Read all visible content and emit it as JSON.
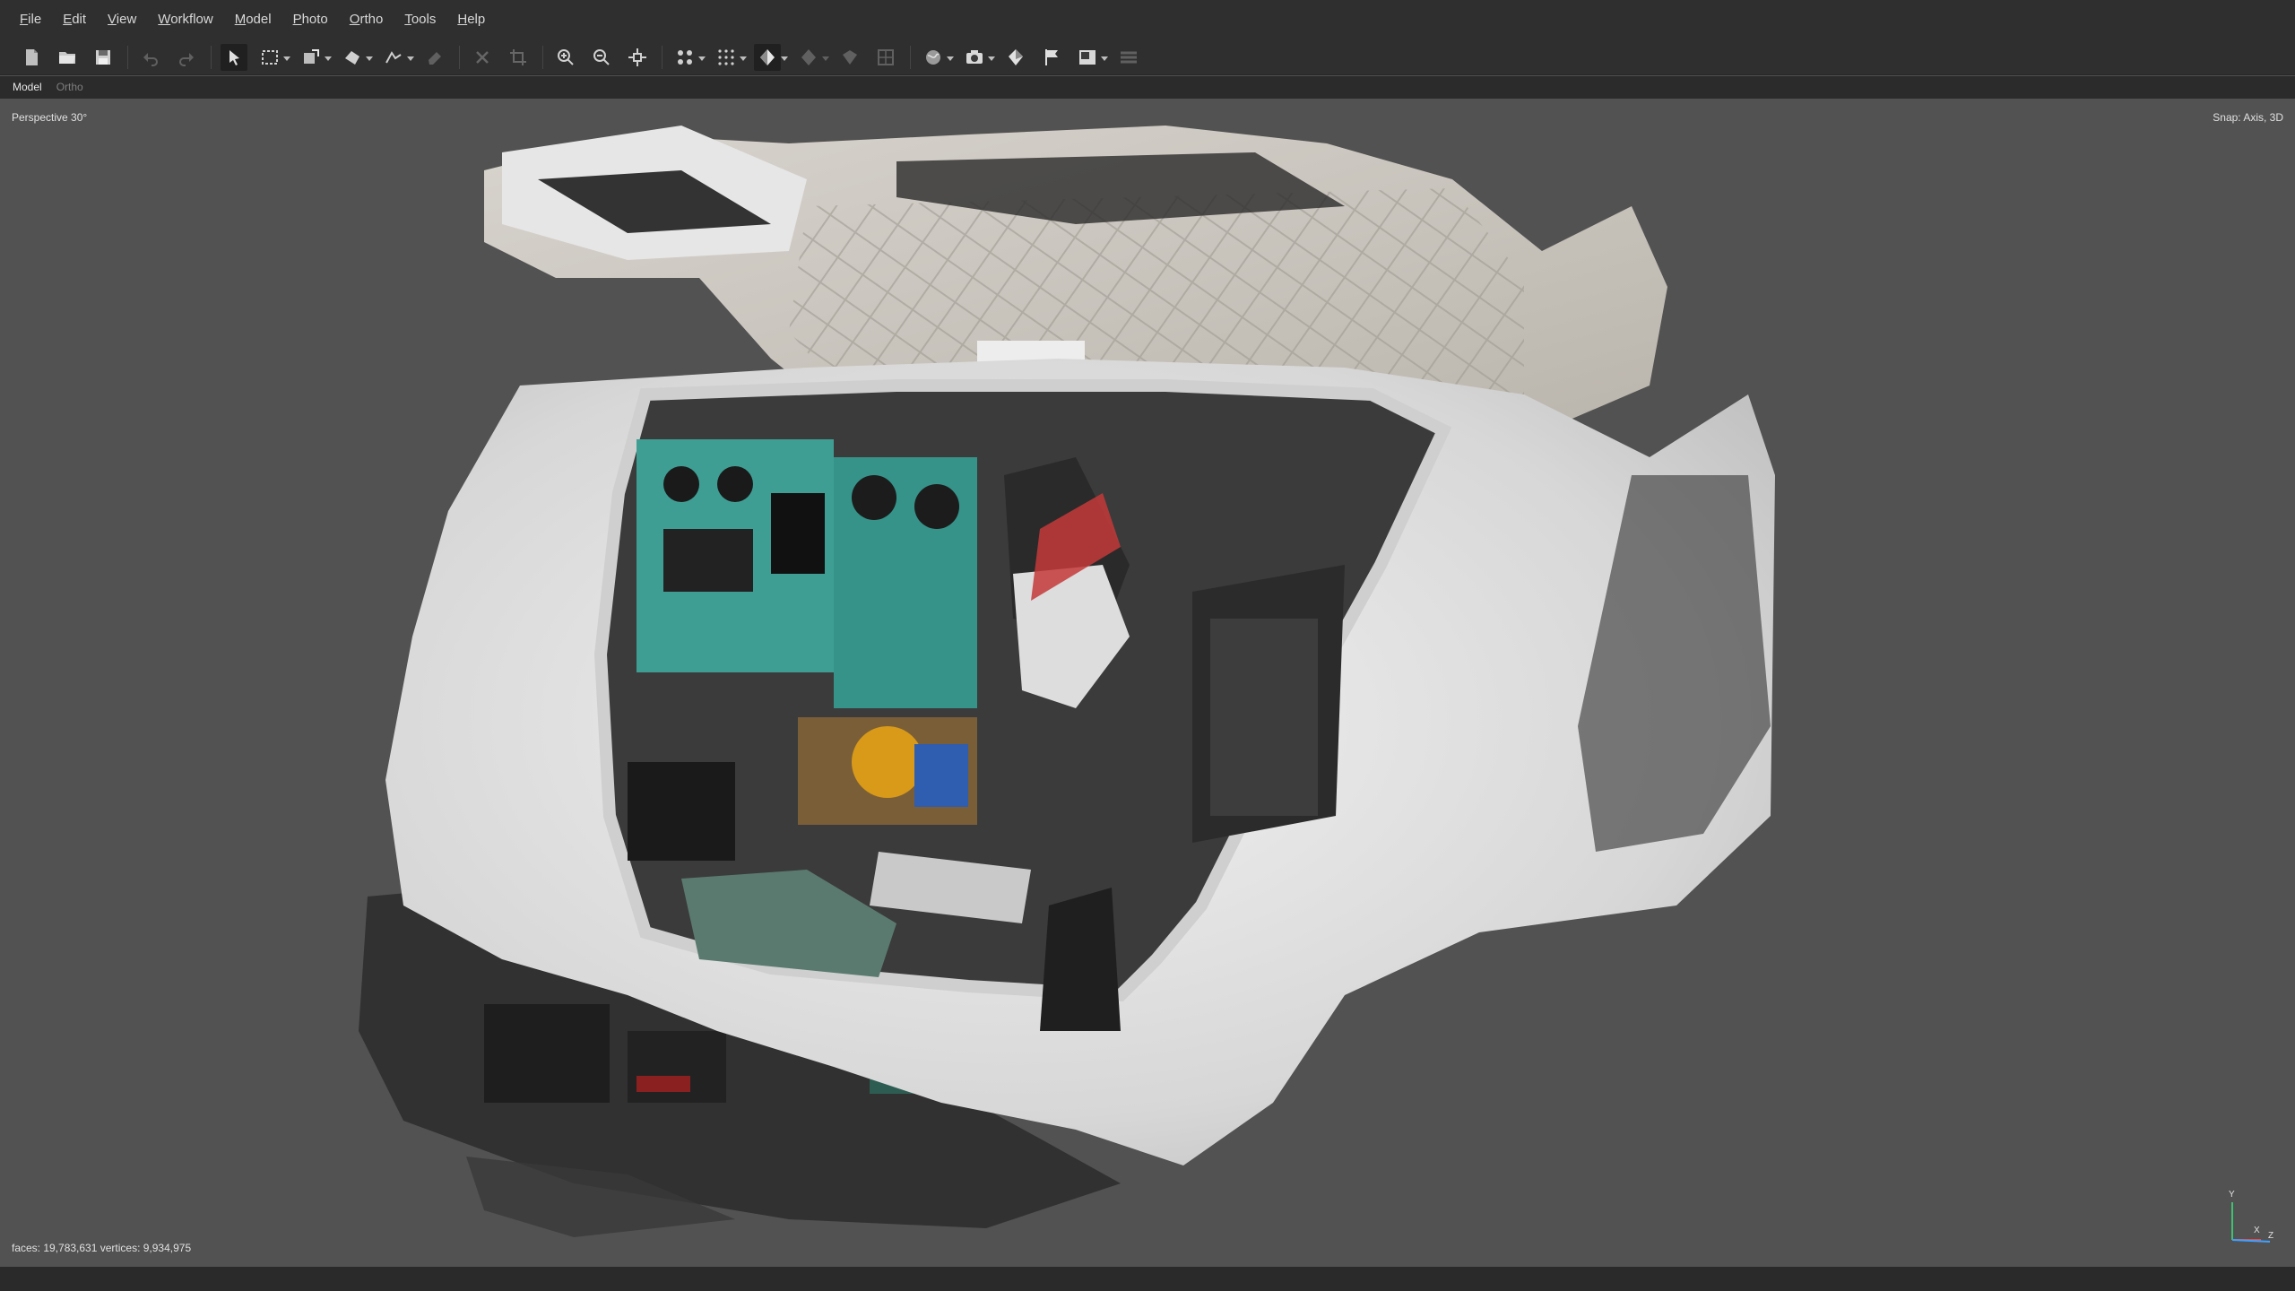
{
  "menu": [
    {
      "label": "File",
      "key": "F",
      "rest": "ile"
    },
    {
      "label": "Edit",
      "key": "E",
      "rest": "dit"
    },
    {
      "label": "View",
      "key": "V",
      "rest": "iew"
    },
    {
      "label": "Workflow",
      "key": "W",
      "rest": "orkflow"
    },
    {
      "label": "Model",
      "key": "M",
      "rest": "odel"
    },
    {
      "label": "Photo",
      "key": "P",
      "rest": "hoto"
    },
    {
      "label": "Ortho",
      "key": "O",
      "rest": "rtho"
    },
    {
      "label": "Tools",
      "key": "T",
      "rest": "ools"
    },
    {
      "label": "Help",
      "key": "H",
      "rest": "elp"
    }
  ],
  "toolbar_icons": [
    "new-document-icon",
    "open-folder-icon",
    "save-icon",
    "undo-icon",
    "redo-icon",
    "pointer-icon",
    "rectangle-selection-icon",
    "transform-region-icon",
    "shape-icon",
    "ruler-icon",
    "eraser-icon",
    "delete-icon",
    "crop-icon",
    "zoom-in-icon",
    "zoom-out-icon",
    "reset-view-icon",
    "cameras-icon",
    "point-cloud-icon",
    "shaded-model-icon",
    "solid-model-icon",
    "texture-icon",
    "tiled-model-icon",
    "globe-icon",
    "camera-icon",
    "markers-icon",
    "flag-icon",
    "image-icon",
    "layers-icon"
  ],
  "tabs": {
    "model": "Model",
    "ortho": "Ortho"
  },
  "viewport": {
    "projection": "Perspective 30°",
    "snap": "Snap: Axis, 3D",
    "stats": "faces: 19,783,631 vertices: 9,934,975"
  },
  "axis": {
    "y": "Y",
    "x": "X",
    "z": "Z"
  },
  "colors": {
    "accent_green": "#3bd36b",
    "axis_x": "#e0e0e0",
    "axis_y": "#e0e0e0",
    "axis_z": "#40a0ff"
  }
}
